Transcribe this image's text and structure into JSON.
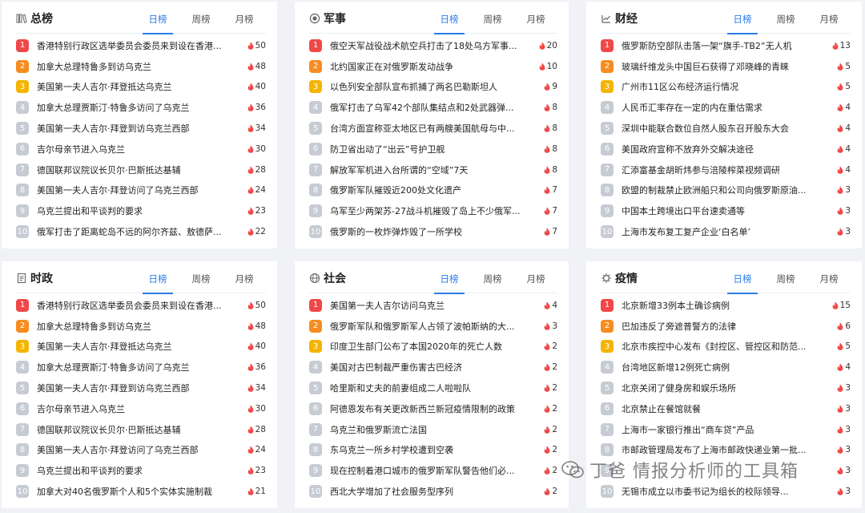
{
  "colors": {
    "accent": "#2b7de9",
    "rank1": "#f04848",
    "rank2": "#f78c1f",
    "rank3": "#f5b400",
    "rank_other": "#c6cbd4",
    "heat": "#f04848"
  },
  "panels": [
    {
      "title": "总榜",
      "icon": "library-icon",
      "tabs": [
        "日榜",
        "周榜",
        "月榜"
      ],
      "items": [
        {
          "rank": "1",
          "title": "香港特别行政区选举委员会委员来到设在香港...",
          "heat": "50"
        },
        {
          "rank": "2",
          "title": "加拿大总理特鲁多到访乌克兰",
          "heat": "48"
        },
        {
          "rank": "3",
          "title": "美国第一夫人吉尔·拜登抵达乌克兰",
          "heat": "40"
        },
        {
          "rank": "4",
          "title": "加拿大总理贾斯汀·特鲁多访问了乌克兰",
          "heat": "36"
        },
        {
          "rank": "5",
          "title": "美国第一夫人吉尔·拜登到访乌克兰西部",
          "heat": "34"
        },
        {
          "rank": "6",
          "title": "吉尔母亲节进入乌克兰",
          "heat": "30"
        },
        {
          "rank": "7",
          "title": "德国联邦议院议长贝尔·巴斯抵达基辅",
          "heat": "28"
        },
        {
          "rank": "8",
          "title": "美国第一夫人吉尔·拜登访问了乌克兰西部",
          "heat": "24"
        },
        {
          "rank": "9",
          "title": "乌克兰提出和平谈判的要求",
          "heat": "23"
        },
        {
          "rank": "10",
          "title": "俄军打击了距离蛇岛不远的阿尔齐兹、敖德萨...",
          "heat": "22"
        }
      ]
    },
    {
      "title": "军事",
      "icon": "medal-icon",
      "tabs": [
        "日榜",
        "周榜",
        "月榜"
      ],
      "items": [
        {
          "rank": "1",
          "title": "俄空天军战役战术航空兵打击了18处乌方军事...",
          "heat": "20"
        },
        {
          "rank": "2",
          "title": "北约国家正在对俄罗斯发动战争",
          "heat": "10"
        },
        {
          "rank": "3",
          "title": "以色列安全部队宣布抓捕了两名巴勒斯坦人",
          "heat": "9"
        },
        {
          "rank": "4",
          "title": "俄军打击了乌军42个部队集结点和2处武器弹...",
          "heat": "8"
        },
        {
          "rank": "5",
          "title": "台湾方面宣称亚太地区已有两艘美国航母与中...",
          "heat": "8"
        },
        {
          "rank": "6",
          "title": "防卫省出动了“出云”号护卫舰",
          "heat": "8"
        },
        {
          "rank": "7",
          "title": "解放军军机进入台所谓的“空域”7天",
          "heat": "8"
        },
        {
          "rank": "8",
          "title": "俄罗斯军队摧毁近200处文化遗产",
          "heat": "7"
        },
        {
          "rank": "9",
          "title": "乌军至少两架苏-27战斗机摧毁了岛上不少俄军...",
          "heat": "7"
        },
        {
          "rank": "10",
          "title": "俄罗斯的一枚炸弹炸毁了一所学校",
          "heat": "7"
        }
      ]
    },
    {
      "title": "财经",
      "icon": "chart-icon",
      "tabs": [
        "日榜",
        "周榜",
        "月榜"
      ],
      "items": [
        {
          "rank": "1",
          "title": "俄罗斯防空部队击落一架“旗手-TB2”无人机",
          "heat": "13"
        },
        {
          "rank": "2",
          "title": "玻璃纤维龙头中国巨石获得了邓晓峰的青睐",
          "heat": "5"
        },
        {
          "rank": "3",
          "title": "广州市11区公布经济运行情况",
          "heat": "5"
        },
        {
          "rank": "4",
          "title": "人民币汇率存在一定的内在重估需求",
          "heat": "4"
        },
        {
          "rank": "5",
          "title": "深圳中能联合数位自然人股东召开股东大会",
          "heat": "4"
        },
        {
          "rank": "6",
          "title": "美国政府宣称不放弃外交解决途径",
          "heat": "4"
        },
        {
          "rank": "7",
          "title": "汇添富基金胡昕炜参与涪陵榨菜视频调研",
          "heat": "4"
        },
        {
          "rank": "8",
          "title": "欧盟的制裁禁止欧洲船只和公司向俄罗斯原油...",
          "heat": "3"
        },
        {
          "rank": "9",
          "title": "中国本土跨境出口平台速卖通等",
          "heat": "3"
        },
        {
          "rank": "10",
          "title": "上海市发布复工复产企业‘白名单’",
          "heat": "3"
        }
      ]
    },
    {
      "title": "时政",
      "icon": "document-icon",
      "tabs": [
        "日榜",
        "周榜",
        "月榜"
      ],
      "items": [
        {
          "rank": "1",
          "title": "香港特别行政区选举委员会委员来到设在香港...",
          "heat": "50"
        },
        {
          "rank": "2",
          "title": "加拿大总理特鲁多到访乌克兰",
          "heat": "48"
        },
        {
          "rank": "3",
          "title": "美国第一夫人吉尔·拜登抵达乌克兰",
          "heat": "40"
        },
        {
          "rank": "4",
          "title": "加拿大总理贾斯汀·特鲁多访问了乌克兰",
          "heat": "36"
        },
        {
          "rank": "5",
          "title": "美国第一夫人吉尔·拜登到访乌克兰西部",
          "heat": "34"
        },
        {
          "rank": "6",
          "title": "吉尔母亲节进入乌克兰",
          "heat": "30"
        },
        {
          "rank": "7",
          "title": "德国联邦议院议长贝尔·巴斯抵达基辅",
          "heat": "28"
        },
        {
          "rank": "8",
          "title": "美国第一夫人吉尔·拜登访问了乌克兰西部",
          "heat": "24"
        },
        {
          "rank": "9",
          "title": "乌克兰提出和平谈判的要求",
          "heat": "23"
        },
        {
          "rank": "10",
          "title": "加拿大对40名俄罗斯个人和5个实体实施制裁",
          "heat": "21"
        }
      ]
    },
    {
      "title": "社会",
      "icon": "globe-icon",
      "tabs": [
        "日榜",
        "周榜",
        "月榜"
      ],
      "items": [
        {
          "rank": "1",
          "title": "美国第一夫人吉尔访问乌克兰",
          "heat": "4"
        },
        {
          "rank": "2",
          "title": "俄罗斯军队和俄罗斯军人占领了波帕斯纳的大...",
          "heat": "3"
        },
        {
          "rank": "3",
          "title": "印度卫生部门公布了本国2020年的死亡人数",
          "heat": "2"
        },
        {
          "rank": "4",
          "title": "美国对古巴制裁严重伤害古巴经济",
          "heat": "2"
        },
        {
          "rank": "5",
          "title": "哈里斯和丈夫的前妻组成二人啦啦队",
          "heat": "2"
        },
        {
          "rank": "6",
          "title": "阿德恩发布有关更改新西兰新冠疫情限制的政策",
          "heat": "2"
        },
        {
          "rank": "7",
          "title": "乌克兰和俄罗斯流亡法国",
          "heat": "2"
        },
        {
          "rank": "8",
          "title": "东乌克兰一所乡村学校遭到空袭",
          "heat": "2"
        },
        {
          "rank": "9",
          "title": "现在控制着港口城市的俄罗斯军队警告他们必...",
          "heat": "2"
        },
        {
          "rank": "10",
          "title": "西北大学增加了社会服务型序列",
          "heat": "2"
        }
      ]
    },
    {
      "title": "疫情",
      "icon": "virus-icon",
      "tabs": [
        "日榜",
        "周榜",
        "月榜"
      ],
      "items": [
        {
          "rank": "1",
          "title": "北京新增33例本土确诊病例",
          "heat": "15"
        },
        {
          "rank": "2",
          "title": "巴加违反了旁遮普警方的法律",
          "heat": "6"
        },
        {
          "rank": "3",
          "title": "北京市疾控中心发布《封控区、管控区和防范...",
          "heat": "5"
        },
        {
          "rank": "4",
          "title": "台湾地区新增12例死亡病例",
          "heat": "4"
        },
        {
          "rank": "5",
          "title": "北京关闭了健身房和娱乐场所",
          "heat": "3"
        },
        {
          "rank": "6",
          "title": "北京禁止在餐馆就餐",
          "heat": "3"
        },
        {
          "rank": "7",
          "title": "上海市一家银行推出“商车贷”产品",
          "heat": "3"
        },
        {
          "rank": "8",
          "title": "市邮政管理局发布了上海市邮政快递业第一批...",
          "heat": "3"
        },
        {
          "rank": "9",
          "title": "",
          "heat": "3"
        },
        {
          "rank": "10",
          "title": "无锡市成立以市委书记为组长的校际领导...",
          "heat": "3"
        }
      ]
    }
  ],
  "watermark": {
    "text": "丁爸 情报分析师的工具箱",
    "icon": "wechat-icon"
  }
}
